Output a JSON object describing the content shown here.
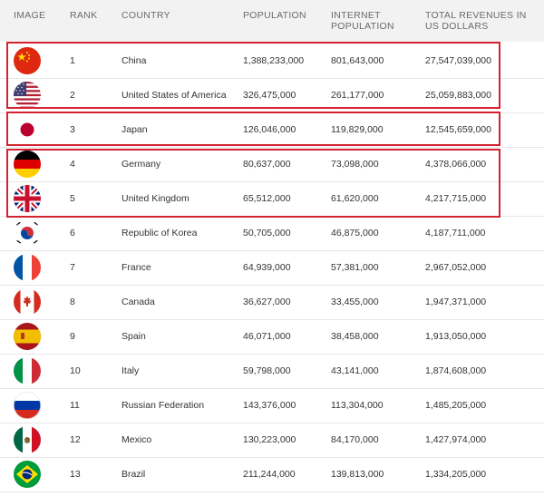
{
  "header": {
    "image": "IMAGE",
    "rank": "RANK",
    "country": "COUNTRY",
    "population": "POPULATION",
    "internet_population": "INTERNET POPULATION",
    "revenues": "TOTAL REVENUES IN US DOLLARS"
  },
  "rows": [
    {
      "flag": "china-flag-icon",
      "rank": "1",
      "country": "China",
      "population": "1,388,233,000",
      "internet": "801,643,000",
      "revenue": "27,547,039,000"
    },
    {
      "flag": "usa-flag-icon",
      "rank": "2",
      "country": "United States of America",
      "population": "326,475,000",
      "internet": "261,177,000",
      "revenue": "25,059,883,000"
    },
    {
      "flag": "japan-flag-icon",
      "rank": "3",
      "country": "Japan",
      "population": "126,046,000",
      "internet": "119,829,000",
      "revenue": "12,545,659,000"
    },
    {
      "flag": "germany-flag-icon",
      "rank": "4",
      "country": "Germany",
      "population": "80,637,000",
      "internet": "73,098,000",
      "revenue": "4,378,066,000"
    },
    {
      "flag": "uk-flag-icon",
      "rank": "5",
      "country": "United Kingdom",
      "population": "65,512,000",
      "internet": "61,620,000",
      "revenue": "4,217,715,000"
    },
    {
      "flag": "korea-flag-icon",
      "rank": "6",
      "country": "Republic of Korea",
      "population": "50,705,000",
      "internet": "46,875,000",
      "revenue": "4,187,711,000"
    },
    {
      "flag": "france-flag-icon",
      "rank": "7",
      "country": "France",
      "population": "64,939,000",
      "internet": "57,381,000",
      "revenue": "2,967,052,000"
    },
    {
      "flag": "canada-flag-icon",
      "rank": "8",
      "country": "Canada",
      "population": "36,627,000",
      "internet": "33,455,000",
      "revenue": "1,947,371,000"
    },
    {
      "flag": "spain-flag-icon",
      "rank": "9",
      "country": "Spain",
      "population": "46,071,000",
      "internet": "38,458,000",
      "revenue": "1,913,050,000"
    },
    {
      "flag": "italy-flag-icon",
      "rank": "10",
      "country": "Italy",
      "population": "59,798,000",
      "internet": "43,141,000",
      "revenue": "1,874,608,000"
    },
    {
      "flag": "russia-flag-icon",
      "rank": "11",
      "country": "Russian Federation",
      "population": "143,376,000",
      "internet": "113,304,000",
      "revenue": "1,485,205,000"
    },
    {
      "flag": "mexico-flag-icon",
      "rank": "12",
      "country": "Mexico",
      "population": "130,223,000",
      "internet": "84,170,000",
      "revenue": "1,427,974,000"
    },
    {
      "flag": "brazil-flag-icon",
      "rank": "13",
      "country": "Brazil",
      "population": "211,244,000",
      "internet": "139,813,000",
      "revenue": "1,334,205,000"
    }
  ],
  "colors": {
    "highlight": "#d42230"
  }
}
